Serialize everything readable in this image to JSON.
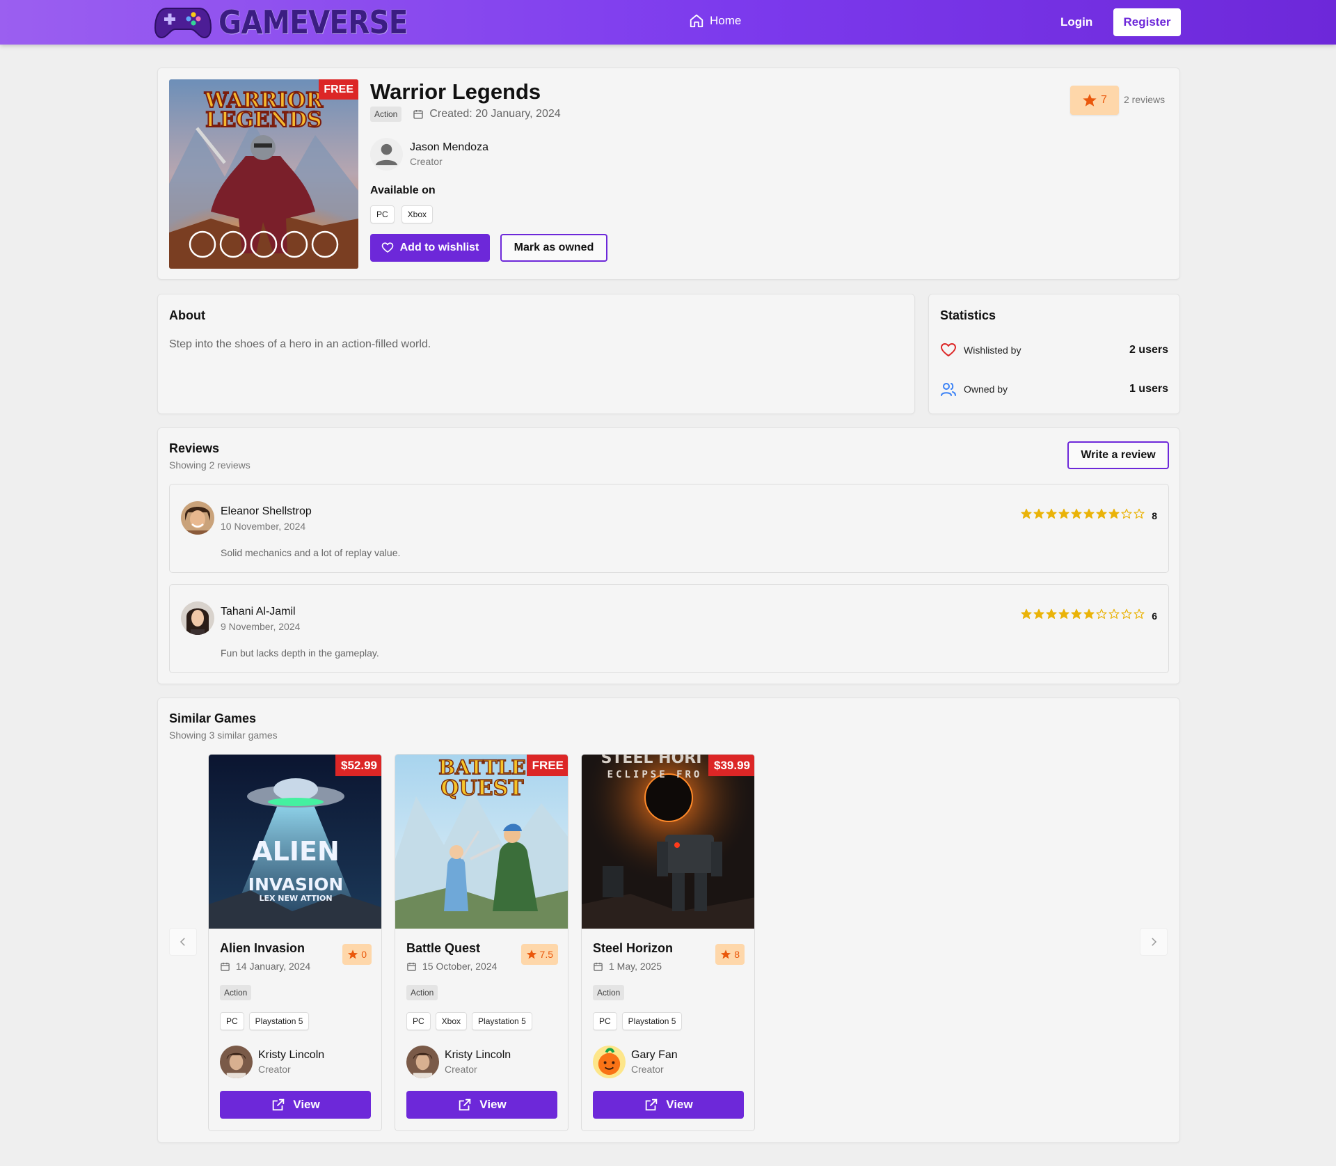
{
  "header": {
    "logo_text": "GAMEVERSE",
    "nav_home": "Home",
    "login": "Login",
    "register": "Register"
  },
  "game": {
    "title": "Warrior Legends",
    "price_badge": "FREE",
    "cover_title_line1": "WARRIOR",
    "cover_title_line2": "LEGENDS",
    "genre": "Action",
    "created": "Created: 20 January, 2024",
    "creator_name": "Jason Mendoza",
    "creator_role": "Creator",
    "available_label": "Available on",
    "platforms": [
      "PC",
      "Xbox"
    ],
    "wishlist_button": "Add to wishlist",
    "owned_button": "Mark as owned",
    "rating": "7",
    "reviews_count": "2 reviews"
  },
  "about": {
    "title": "About",
    "text": "Step into the shoes of a hero in an action-filled world."
  },
  "statistics": {
    "title": "Statistics",
    "wishlisted_label": "Wishlisted by",
    "wishlisted_value": "2 users",
    "owned_label": "Owned by",
    "owned_value": "1 users"
  },
  "reviews": {
    "title": "Reviews",
    "subtitle": "Showing 2 reviews",
    "write_button": "Write a review",
    "items": [
      {
        "name": "Eleanor Shellstrop",
        "date": "10 November, 2024",
        "text": "Solid mechanics and a lot of replay value.",
        "score": "8",
        "stars": 8
      },
      {
        "name": "Tahani Al-Jamil",
        "date": "9 November, 2024",
        "text": "Fun but lacks depth in the gameplay.",
        "score": "6",
        "stars": 6
      }
    ]
  },
  "similar": {
    "title": "Similar Games",
    "subtitle": "Showing 3 similar games",
    "games": [
      {
        "title": "Alien Invasion",
        "price": "$52.99",
        "date": "14 January, 2024",
        "rating": "0",
        "genre": "Action",
        "platforms": [
          "PC",
          "Playstation 5"
        ],
        "creator": "Kristy Lincoln",
        "role": "Creator",
        "view": "View",
        "cover_line1": "ALIEN",
        "cover_line2": "INVASION",
        "cover_line3": "LEX NEW ATTION"
      },
      {
        "title": "Battle Quest",
        "price": "FREE",
        "date": "15 October, 2024",
        "rating": "7.5",
        "genre": "Action",
        "platforms": [
          "PC",
          "Xbox",
          "Playstation 5"
        ],
        "creator": "Kristy Lincoln",
        "role": "Creator",
        "view": "View",
        "cover_line1": "BATTLE",
        "cover_line2": "QUEST"
      },
      {
        "title": "Steel Horizon",
        "price": "$39.99",
        "date": "1 May, 2025",
        "rating": "8",
        "genre": "Action",
        "platforms": [
          "PC",
          "Playstation 5"
        ],
        "creator": "Gary Fan",
        "role": "Creator",
        "view": "View",
        "cover_line1": "STEEL HORI",
        "cover_line2": "ECLIPSE FRO"
      }
    ]
  },
  "colors": {
    "accent": "#6d28d9",
    "header_gradient_start": "#9b5ff0",
    "price_badge": "#dc2626",
    "rating_bg": "#fed7aa",
    "rating_fg": "#ea580c",
    "star": "#eab308"
  },
  "icons": [
    "gamepad-icon",
    "home-icon",
    "calendar-icon",
    "user-icon",
    "heart-icon",
    "star-icon",
    "users-icon",
    "chevron-left-icon",
    "chevron-right-icon",
    "external-link-icon"
  ]
}
